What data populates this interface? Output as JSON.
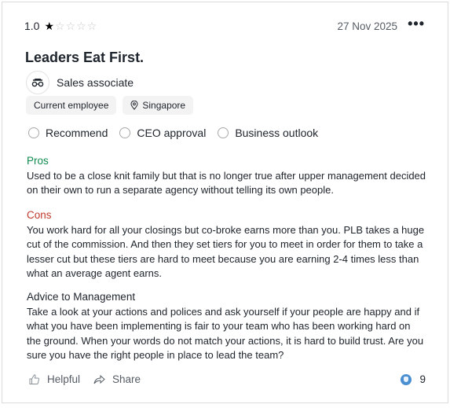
{
  "review": {
    "rating": "1.0",
    "stars_filled": 1,
    "stars_total": 5,
    "date": "27 Nov 2025",
    "more_label": "•••",
    "title": "Leaders Eat First.",
    "job_title": "Sales associate",
    "employment_status": "Current employee",
    "location": "Singapore",
    "indicators": [
      {
        "label": "Recommend"
      },
      {
        "label": "CEO approval"
      },
      {
        "label": "Business outlook"
      }
    ],
    "pros": {
      "heading": "Pros",
      "text": "Used to be a close knit family but that is no longer true after upper management decided on their own to run a separate agency without telling its own people."
    },
    "cons": {
      "heading": "Cons",
      "text": "You work hard for all your closings but co-broke earns more than you. PLB takes a huge cut of the commission. And then they set tiers for you to meet in order for them to take a lesser cut but these tiers are hard to meet because you are earning 2-4 times less than what an average agent earns."
    },
    "advice": {
      "heading": "Advice to Management",
      "text": "Take a look at your actions and polices and ask yourself if your people are happy and if what you have been implementing is fair to your team who has been working hard on the ground. When your words do not match your actions, it is hard to build trust. Are you sure you have the right people in place to lead the team?"
    },
    "footer": {
      "helpful_label": "Helpful",
      "share_label": "Share",
      "helpful_count": "9"
    }
  },
  "colors": {
    "pros_heading": "#0e8a4e",
    "cons_heading": "#c0392b",
    "text": "#20262e",
    "muted": "#555c65"
  }
}
